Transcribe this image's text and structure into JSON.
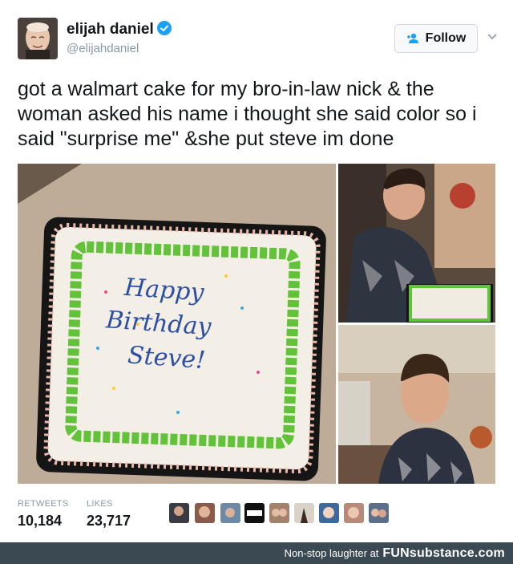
{
  "tweet": {
    "author_name": "elijah daniel",
    "author_handle": "@elijahdaniel",
    "follow_label": "Follow",
    "text": "got a walmart cake for my bro-in-law nick & the woman asked his name i thought she said color so i said \"surprise me\" &she put steve im done",
    "cake_text": [
      "Happy",
      "Birthday",
      "Steve!"
    ]
  },
  "stats": {
    "retweets_label": "RETWEETS",
    "retweets_value": "10,184",
    "likes_label": "LIKES",
    "likes_value": "23,717"
  },
  "footer": {
    "tagline": "Non-stop laughter at",
    "brand": "FUNsubstance.com"
  },
  "colors": {
    "verified": "#1da1f2",
    "footer_bg": "#3b4a52",
    "text": "#14171a",
    "muted": "#8899a6"
  },
  "icons": [
    "verified-badge-icon",
    "follow-person-icon",
    "chevron-down-icon"
  ]
}
